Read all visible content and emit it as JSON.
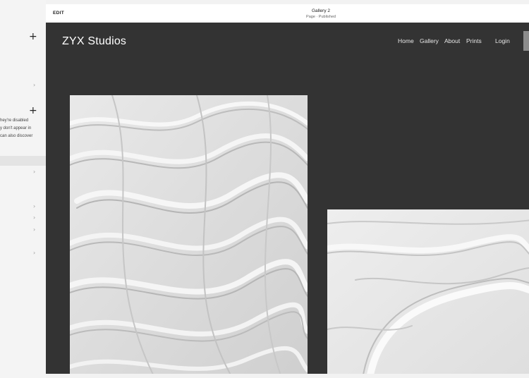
{
  "sidebar": {
    "description_lines": [
      "hey're disabled",
      "y don't appear in",
      "can also discover"
    ]
  },
  "topbar": {
    "edit_label": "EDIT",
    "page_title": "Gallery 2",
    "page_status": "Page · Published"
  },
  "site": {
    "brand": "ZYX Studios",
    "nav": {
      "home": "Home",
      "gallery": "Gallery",
      "about": "About",
      "prints": "Prints",
      "login": "Login"
    },
    "images": [
      {
        "icon": "textured-plaster-image"
      },
      {
        "icon": "textured-plaster-image"
      }
    ]
  },
  "colors": {
    "site_background": "#333333",
    "topbar_background": "#ffffff",
    "sidebar_background": "#f4f4f4"
  }
}
